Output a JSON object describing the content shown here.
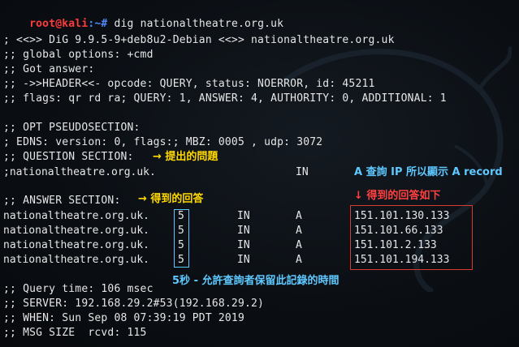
{
  "prompt": {
    "user": "root@kali",
    "path": ":~#",
    "command": " dig nationaltheatre.org.uk"
  },
  "output": {
    "l1": "; <<>> DiG 9.9.5-9+deb8u2-Debian <<>> nationaltheatre.org.uk",
    "l2": ";; global options: +cmd",
    "l3": ";; Got answer:",
    "l4": ";; ->>HEADER<<- opcode: QUERY, status: NOERROR, id: 45211",
    "l5": ";; flags: qr rd ra; QUERY: 1, ANSWER: 4, AUTHORITY: 0, ADDITIONAL: 1",
    "l6": ";; OPT PSEUDOSECTION:",
    "l7": "; EDNS: version: 0, flags:; MBZ: 0005 , udp: 3072",
    "l8": ";; QUESTION SECTION:",
    "question": {
      "name": ";nationaltheatre.org.uk.",
      "class": "IN",
      "type": "A"
    },
    "l9": ";; ANSWER SECTION:",
    "answers": [
      {
        "name": "nationaltheatre.org.uk.",
        "ttl": "5",
        "class": "IN",
        "type": "A",
        "ip": "151.101.130.133"
      },
      {
        "name": "nationaltheatre.org.uk.",
        "ttl": "5",
        "class": "IN",
        "type": "A",
        "ip": "151.101.66.133"
      },
      {
        "name": "nationaltheatre.org.uk.",
        "ttl": "5",
        "class": "IN",
        "type": "A",
        "ip": "151.101.2.133"
      },
      {
        "name": "nationaltheatre.org.uk.",
        "ttl": "5",
        "class": "IN",
        "type": "A",
        "ip": "151.101.194.133"
      }
    ],
    "l10": ";; Query time: 106 msec",
    "l11": ";; SERVER: 192.168.29.2#53(192.168.29.2)",
    "l12": ";; WHEN: Sun Sep 08 07:39:19 PDT 2019",
    "l13": ";; MSG SIZE  rcvd: 115"
  },
  "annotations": {
    "question": "→ 提出的問題",
    "question_record": "A 查詢 IP 所以顯示 A record",
    "answer": "→ 得到的回答",
    "answer_detail": "↓ 得到的回答如下",
    "ttl": "5秒 - 允許查詢者保留此記錄的時間"
  },
  "colors": {
    "yellow": "#ffd800",
    "cyan": "#5ec8ff",
    "red": "#ff4040",
    "prompt_user": "#ff3b3b",
    "prompt_path": "#4f8cff"
  }
}
